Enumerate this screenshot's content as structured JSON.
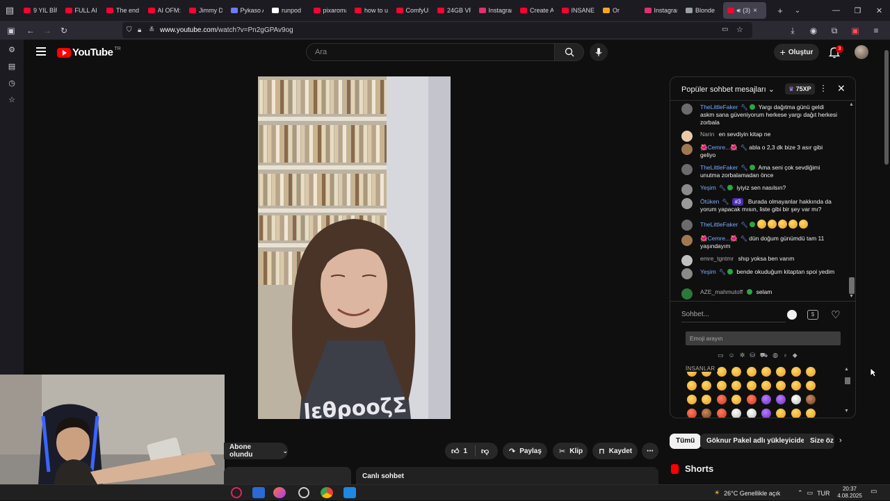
{
  "browser": {
    "tabs": [
      {
        "title": "9 YIL BİR",
        "color": "#ff0033"
      },
      {
        "title": "FULL AI",
        "color": "#ff0033"
      },
      {
        "title": "The end",
        "color": "#ff0033"
      },
      {
        "title": "AI OFM:",
        "color": "#ff0033"
      },
      {
        "title": "Jimmy D",
        "color": "#ff0033"
      },
      {
        "title": "Pykaso A",
        "color": "#6c7bff"
      },
      {
        "title": "runpod",
        "color": "#ffffff"
      },
      {
        "title": "pixaroma",
        "color": "#ff0033"
      },
      {
        "title": "how to u",
        "color": "#ff0033"
      },
      {
        "title": "ComfyUI",
        "color": "#ff0033"
      },
      {
        "title": "24GB VR",
        "color": "#ff0033"
      },
      {
        "title": "Instagram",
        "color": "#e1306c"
      },
      {
        "title": "Create A",
        "color": "#ff0033"
      },
      {
        "title": "INSANE",
        "color": "#ff0033"
      },
      {
        "title": "Or",
        "color": "#f5a623"
      },
      {
        "title": "Instagram",
        "color": "#e1306c"
      },
      {
        "title": "Blonde",
        "color": "#9aa0a6"
      }
    ],
    "active_tab": {
      "title": "(3)",
      "audio_icon": "speaker-icon",
      "close": "×"
    },
    "new_tab": "+",
    "url_host": "www.youtube.com",
    "url_path": "/watch?v=Pn2gGPAv9og"
  },
  "youtube": {
    "logo_text": "YouTube",
    "logo_region": "TR",
    "search_placeholder": "Ara",
    "create_label": "Oluştur",
    "notification_count": "3",
    "actions": {
      "subscribed_label": "Abone olundu",
      "like_count": "1",
      "share_label": "Paylaş",
      "clip_label": "Klip",
      "save_label": "Kaydet",
      "more": "⋯"
    },
    "live_chat_label": "Canlı sohbet",
    "chips": [
      "Tümü",
      "Göknur Pakel adlı yükleyiciden",
      "Size öz"
    ],
    "shorts_label": "Shorts"
  },
  "chat": {
    "title": "Popüler sohbet mesajları",
    "xp_badge": "75XP",
    "messages": [
      {
        "author": "TheLittleFaker",
        "mod": true,
        "verified": true,
        "text": "Yargı dağıtma günü geldi askm sana güveniyorum herkese yargı dağıt herkesi zorbala",
        "avatar_color": "#6b6b6b"
      },
      {
        "author": "Narin",
        "mod": false,
        "text": "en sevdiyin kitap ne",
        "avatar_color": "#e8c9a8"
      },
      {
        "author": "🌺Cemre...🌺",
        "mod": true,
        "text": "abla o 2,3 dk bize 3 asır gibi geliyo",
        "avatar_color": "#a07850"
      },
      {
        "author": "TheLittleFaker",
        "mod": true,
        "verified": true,
        "text": "Ama seni çok sevdiğimi unutma zorbalamadan önce",
        "avatar_color": "#6b6b6b"
      },
      {
        "author": "Yeşim",
        "mod": true,
        "verified": true,
        "text": "iyiyiz sen nasılsın?",
        "avatar_color": "#8a8a8a"
      },
      {
        "author": "Ötüken",
        "mod": true,
        "rank": "#3",
        "text": "Burada olmayanlar hakkında da yorum yapacak mısın, liste gibi bir şey var mı?",
        "avatar_color": "#9a9a9a"
      },
      {
        "author": "TheLittleFaker",
        "mod": true,
        "verified": true,
        "text": "",
        "emoji_count": 5,
        "avatar_color": "#6b6b6b"
      },
      {
        "author": "🌺Cemre...🌺",
        "mod": true,
        "text": "dün doğum günümdü tam 11 yaşındayım",
        "avatar_color": "#a07850"
      },
      {
        "author": "emre_tgntmr",
        "mod": false,
        "text": "shıp yoksa ben varım",
        "avatar_color": "#c0c0c0"
      },
      {
        "author": "Yeşim",
        "mod": true,
        "verified": true,
        "text": "bende okuduğum kitaptan spoi yedim",
        "avatar_color": "#8a8a8a"
      },
      {
        "author": "AZE_mahmutoff",
        "mod": false,
        "verified": true,
        "text": "selam",
        "avatar_color": "#2a7a3a"
      }
    ],
    "input_placeholder": "Sohbet...",
    "emoji_search_placeholder": "Emoji arayın",
    "emoji_category_label": "İNSANLAR"
  },
  "taskbar": {
    "weather": "26°C  Genellikle açık",
    "language": "TUR",
    "time": "20:37",
    "date": "4.08.2025"
  }
}
